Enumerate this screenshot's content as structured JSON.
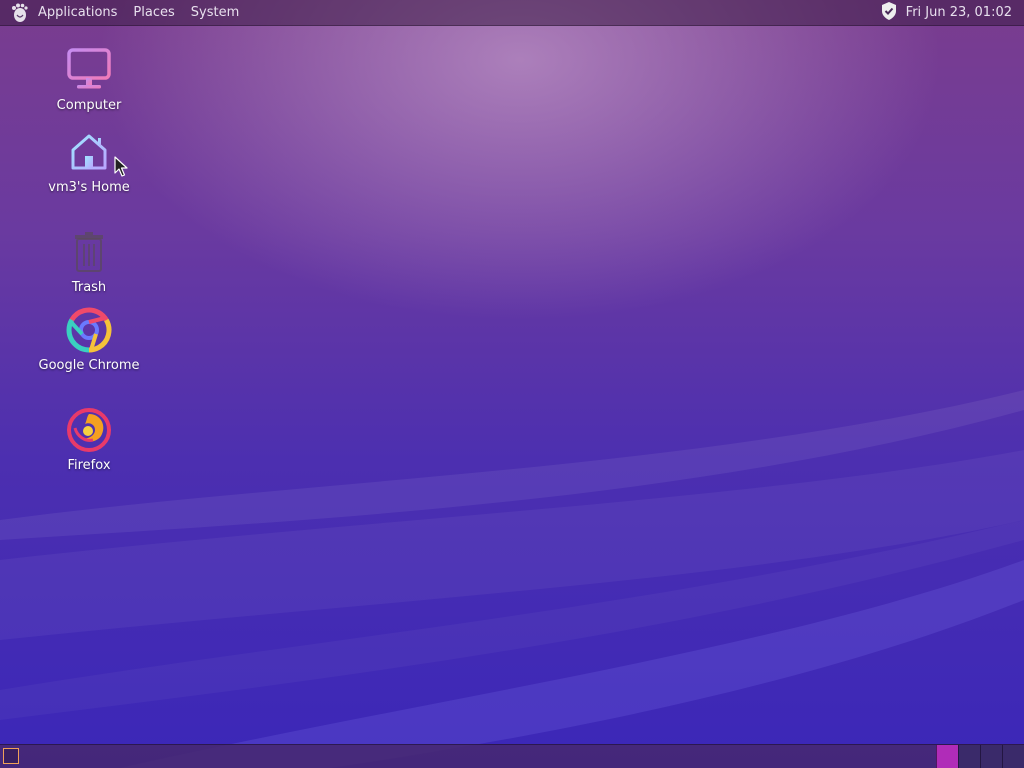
{
  "top_panel": {
    "menus": [
      "Applications",
      "Places",
      "System"
    ],
    "clock": "Fri Jun 23, 01:02"
  },
  "desktop_icons": [
    {
      "label": "Computer",
      "icon": "computer-icon"
    },
    {
      "label": "vm3's Home",
      "icon": "home-folder-icon"
    },
    {
      "label": "Trash",
      "icon": "trash-icon"
    },
    {
      "label": "Google Chrome",
      "icon": "google-chrome-icon"
    },
    {
      "label": "Firefox",
      "icon": "firefox-icon"
    }
  ],
  "bottom_panel": {
    "workspaces": 4,
    "active_workspace": 1
  },
  "colors": {
    "panel_text": "#e8e0ee",
    "active_workspace": "#b02cb8",
    "show_desktop_border": "#f0a058"
  }
}
